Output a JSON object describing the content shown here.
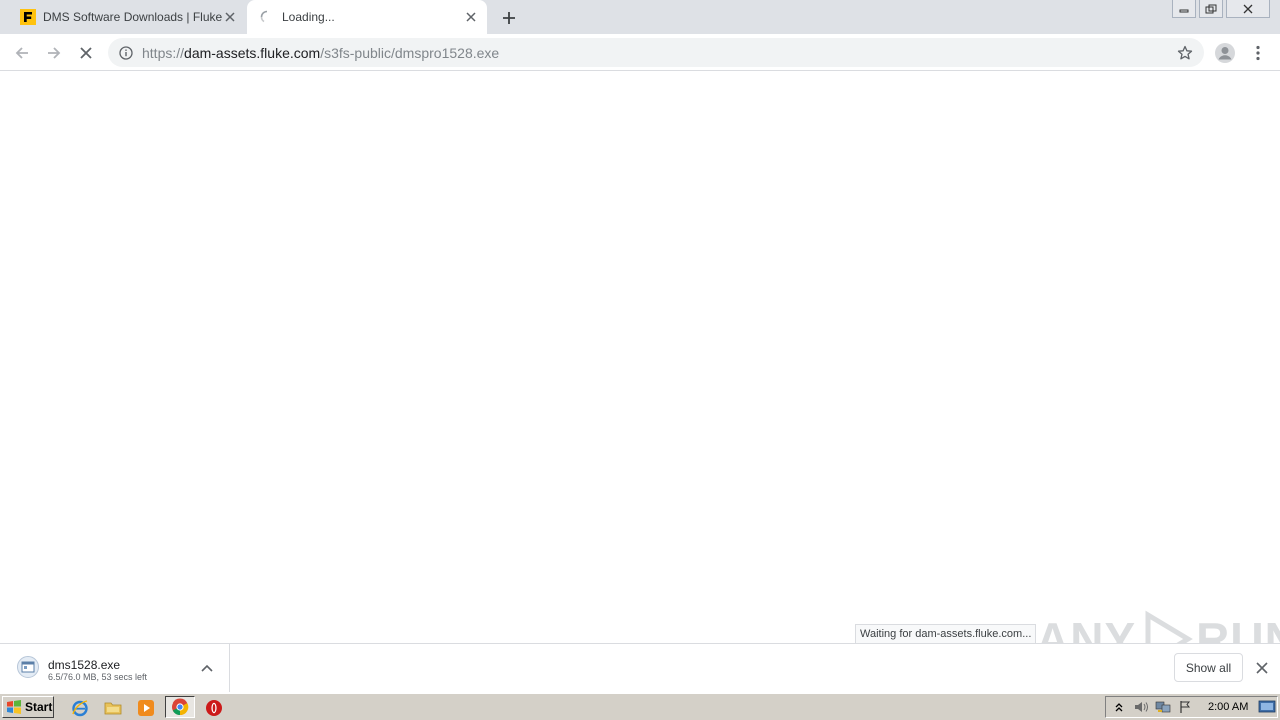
{
  "browser": {
    "tabs": [
      {
        "title": "DMS Software Downloads | Fluke",
        "state": "inactive",
        "favicon": "fluke-logo-icon"
      },
      {
        "title": "Loading...",
        "state": "active",
        "favicon": "loading-spinner-icon"
      }
    ],
    "url": {
      "scheme": "https://",
      "host": "dam-assets.fluke.com",
      "path": "/s3fs-public/dmspro1528.exe"
    },
    "status_bubble": "Waiting for dam-assets.fluke.com..."
  },
  "download_shelf": {
    "item": {
      "filename": "dms1528.exe",
      "status": "6.5/76.0 MB, 53 secs left"
    },
    "show_all_label": "Show all"
  },
  "watermark": {
    "text_left": "ANY",
    "text_right": "RUN"
  },
  "taskbar": {
    "start_label": "Start",
    "apps": [
      "internet-explorer-icon",
      "file-explorer-icon",
      "media-player-icon",
      "chrome-icon",
      "opera-icon"
    ],
    "clock": "2:00 AM"
  },
  "colors": {
    "tabstrip_bg": "#dee1e6",
    "omnibox_bg": "#f1f3f4",
    "taskbar_bg": "#d4d0c8",
    "fluke_yellow": "#ffc20e"
  }
}
